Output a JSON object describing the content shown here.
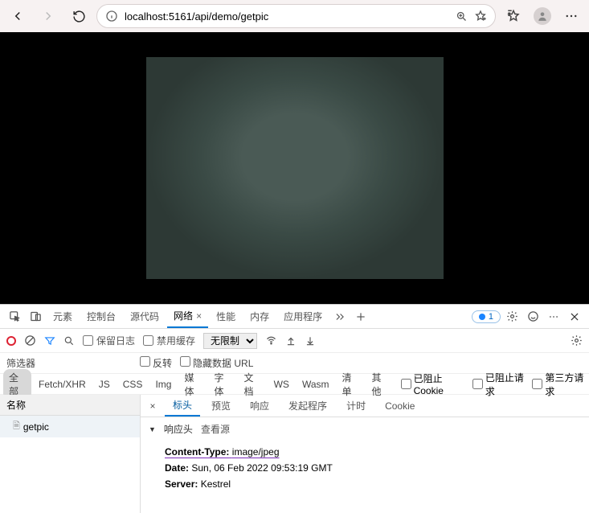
{
  "toolbar": {
    "url": "localhost:5161/api/demo/getpic"
  },
  "devtools": {
    "tabs": [
      "元素",
      "控制台",
      "源代码",
      "网络",
      "性能",
      "内存",
      "应用程序"
    ],
    "active_tab_index": 3,
    "issues_count": "1",
    "network_bar": {
      "preserve_log": "保留日志",
      "disable_cache": "禁用缓存",
      "throttle": "无限制"
    },
    "filter_bar": {
      "filter_label": "筛选器",
      "invert": "反转",
      "hide_data_urls": "隐藏数据 URL"
    },
    "type_filters": [
      "全部",
      "Fetch/XHR",
      "JS",
      "CSS",
      "Img",
      "媒体",
      "字体",
      "文档",
      "WS",
      "Wasm",
      "清单",
      "其他"
    ],
    "type_checks": {
      "blocked_cookies": "已阻止 Cookie",
      "blocked_requests": "已阻止请求",
      "third_party": "第三方请求"
    },
    "request_list": {
      "header": "名称",
      "items": [
        "getpic"
      ]
    },
    "detail": {
      "tabs": [
        "标头",
        "预览",
        "响应",
        "发起程序",
        "计时",
        "Cookie"
      ],
      "active_tab_index": 0,
      "section_title": "响应头",
      "view_source": "查看源",
      "headers": {
        "content_type_k": "Content-Type:",
        "content_type_v": "image/jpeg",
        "date_k": "Date:",
        "date_v": "Sun, 06 Feb 2022 09:53:19 GMT",
        "server_k": "Server:",
        "server_v": "Kestrel"
      }
    }
  }
}
